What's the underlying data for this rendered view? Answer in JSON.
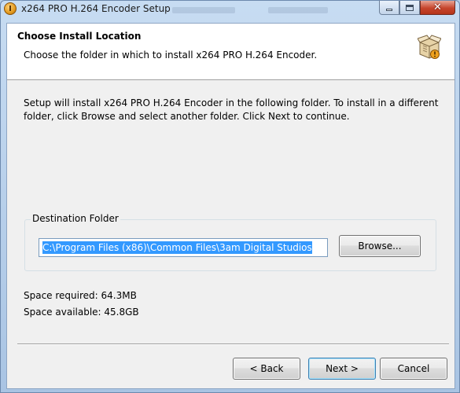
{
  "window": {
    "title": "x264 PRO H.264 Encoder Setup",
    "icon": "setup-app-icon"
  },
  "header": {
    "title": "Choose Install Location",
    "subtitle": "Choose the folder in which to install x264 PRO H.264 Encoder.",
    "icon": "installer-box-icon"
  },
  "body": {
    "intro": "Setup will install x264 PRO H.264 Encoder in the following folder. To install in a different folder, click Browse and select another folder. Click Next to continue."
  },
  "destination": {
    "legend": "Destination Folder",
    "path": "C:\\Program Files (x86)\\Common Files\\3am Digital Studios",
    "browse_label": "Browse..."
  },
  "space": {
    "required": "Space required: 64.3MB",
    "available": "Space available: 45.8GB"
  },
  "buttons": {
    "back": "< Back",
    "next": "Next >",
    "cancel": "Cancel"
  },
  "colors": {
    "selection": "#3399ff",
    "close_button": "#c6452c",
    "default_button_border": "#3c7fb1"
  }
}
